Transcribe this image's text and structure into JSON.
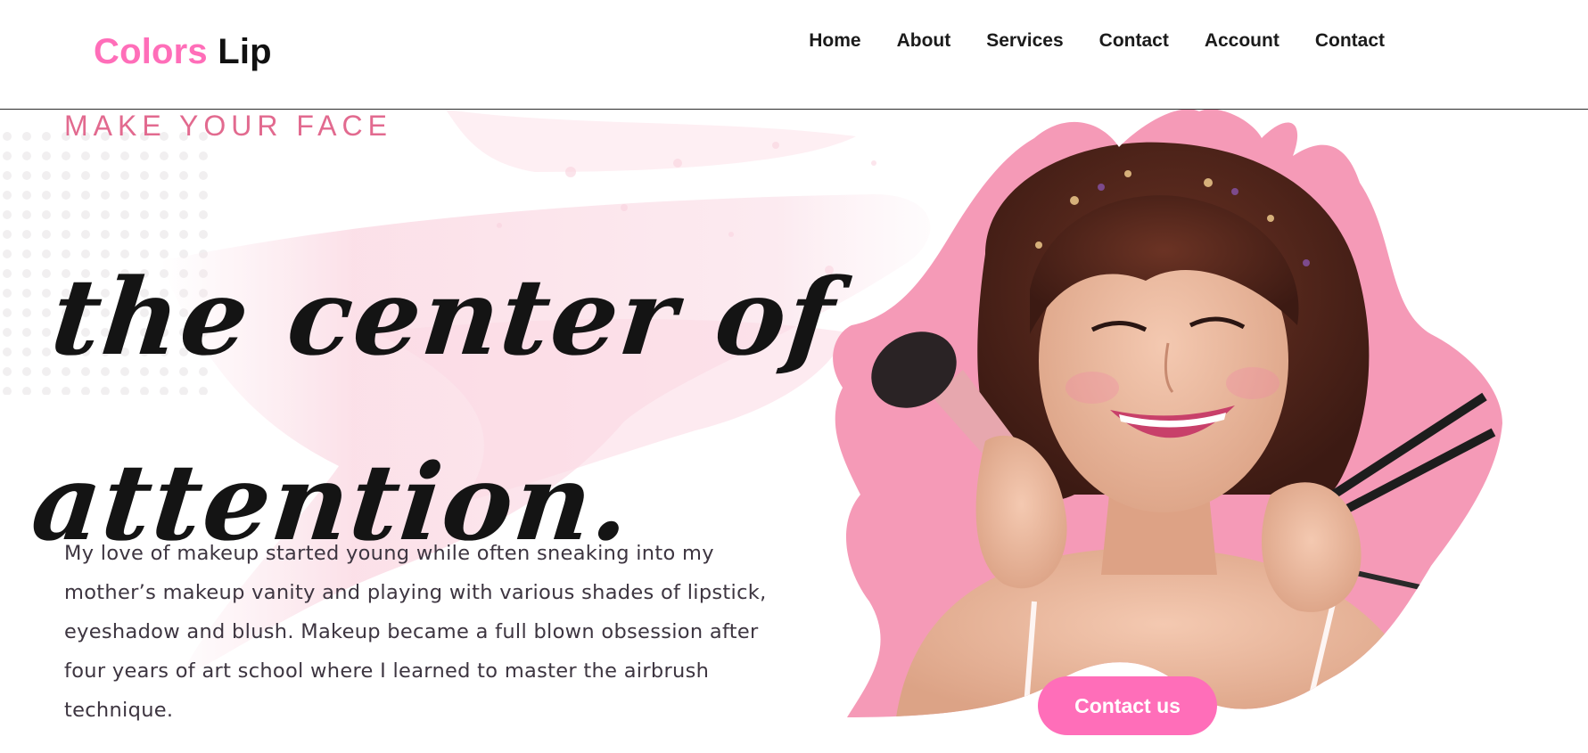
{
  "brand": {
    "name_part1": "Colors",
    "name_part2": "Lip",
    "accent_color": "#ff6eb9"
  },
  "nav": {
    "items": [
      {
        "label": "Home"
      },
      {
        "label": "About"
      },
      {
        "label": "Services"
      },
      {
        "label": "Contact"
      },
      {
        "label": "Account"
      },
      {
        "label": "Contact"
      }
    ]
  },
  "hero": {
    "eyebrow": "MAKE YOUR FACE",
    "script_line1": "the center of",
    "script_line2": "attention.",
    "intro": "My love of makeup started young while often sneaking into my mother’s makeup vanity and playing with various shades of lipstick, eyeshadow and blush. Makeup became a full blown obsession after four years of art school where I learned to master the airbrush technique.",
    "image_name": "smiling-woman-holding-makeup-brushes",
    "cta_label": "Contact us"
  }
}
